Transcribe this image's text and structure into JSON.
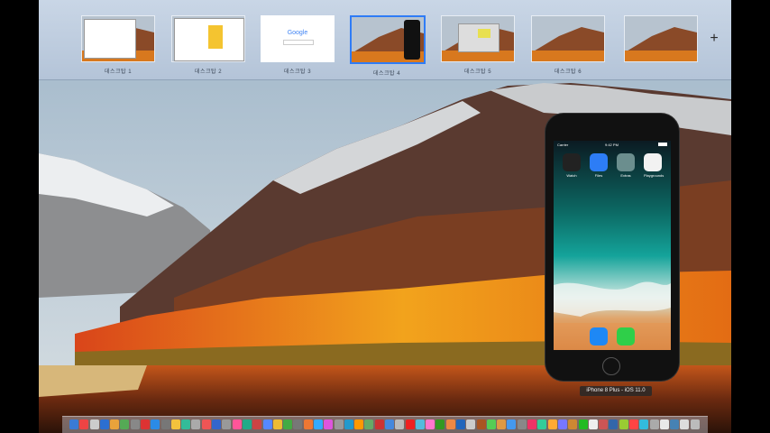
{
  "spaces": [
    {
      "label": "데스크탑 1",
      "kind": "doc"
    },
    {
      "label": "데스크탑 2",
      "kind": "doc2"
    },
    {
      "label": "데스크탑 3",
      "kind": "google"
    },
    {
      "label": "데스크탑 4",
      "kind": "phone",
      "active": true
    },
    {
      "label": "데스크탑 5",
      "kind": "mini"
    },
    {
      "label": "데스크탑 6",
      "kind": "empty"
    },
    {
      "label": "",
      "kind": "empty"
    }
  ],
  "thumb_google_text": "Google",
  "add_space_icon": "plus-icon",
  "phone": {
    "carrier": "Carrier",
    "clock": "9:42 PM",
    "apps": [
      {
        "name": "Watch",
        "color": "#222"
      },
      {
        "name": "Files",
        "color": "#2d7df6"
      },
      {
        "name": "Extras",
        "color": "#6b8e8e"
      },
      {
        "name": "Playgrounds",
        "color": "#f2f2f2"
      }
    ],
    "dock": [
      {
        "name": "Safari",
        "color": "#1e88f5"
      },
      {
        "name": "Messages",
        "color": "#2fcf49"
      }
    ]
  },
  "phone_caption": "iPhone 8 Plus - iOS 11.0",
  "dock_colors": [
    "#3a7bd5",
    "#e44",
    "#ccc",
    "#2c6fd1",
    "#e9a23b",
    "#5a5",
    "#888",
    "#d33",
    "#2b8be6",
    "#777",
    "#f3c23d",
    "#3b9",
    "#aaa",
    "#e55",
    "#36c",
    "#999",
    "#f59",
    "#2a8",
    "#c44",
    "#58f",
    "#eb3",
    "#4a4",
    "#777",
    "#e73",
    "#3af",
    "#d5d",
    "#999",
    "#29c",
    "#f90",
    "#6a6",
    "#c33",
    "#48d",
    "#bbb",
    "#e22",
    "#5bd",
    "#f7c",
    "#392",
    "#e84",
    "#26b",
    "#ccc",
    "#a52",
    "#5c5",
    "#d94",
    "#49e",
    "#888",
    "#e36",
    "#3c9",
    "#fa3",
    "#77f",
    "#c83",
    "#2b2",
    "#eee",
    "#c55",
    "#36a",
    "#9c3",
    "#f44",
    "#3bd",
    "#aaa",
    "#e9e9e9",
    "#4682b4",
    "#ddd",
    "#bbb"
  ]
}
